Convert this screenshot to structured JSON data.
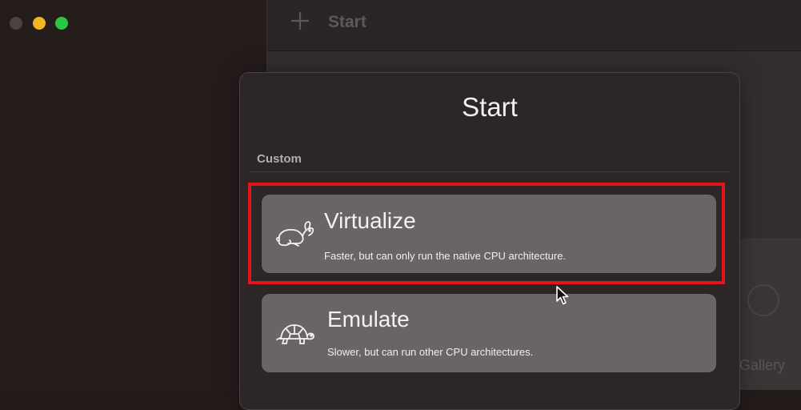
{
  "window": {
    "traffic_lights": {
      "close_color": "#4a4343",
      "minimize_color": "#f3b423",
      "maximize_color": "#28c840"
    }
  },
  "toolbar": {
    "add_icon": "plus-icon",
    "title": "Start"
  },
  "background": {
    "gallery_label": "Gallery"
  },
  "dialog": {
    "title": "Start",
    "section_label": "Custom",
    "options": [
      {
        "icon": "rabbit-icon",
        "title": "Virtualize",
        "description": "Faster, but can only run the native CPU architecture.",
        "highlighted": true
      },
      {
        "icon": "turtle-icon",
        "title": "Emulate",
        "description": "Slower, but can run other CPU architectures.",
        "highlighted": false
      }
    ]
  },
  "annotation": {
    "highlight_color": "#e4141b"
  }
}
